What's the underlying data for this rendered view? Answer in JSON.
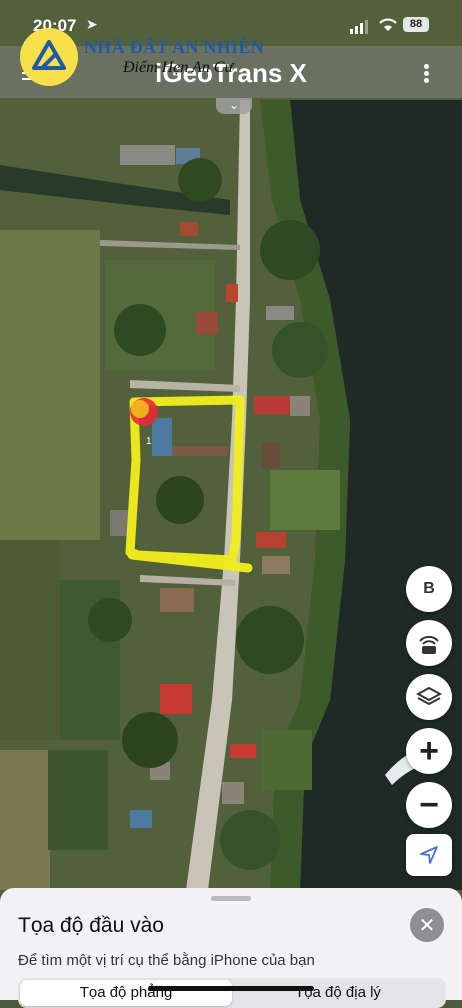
{
  "status": {
    "time": "20:07",
    "battery": "88"
  },
  "app": {
    "title": "iGeoTrans X"
  },
  "watermark": {
    "brand": "NHÀ ĐẤT AN NHIÊN",
    "slogan": "Điểm Hẹn An Cư"
  },
  "map": {
    "parcel_label": "1",
    "highlight_color": "#f2ee1a",
    "marker_color": "#e8283a"
  },
  "controls": {
    "compass_label": "B",
    "zoom_in": "+",
    "zoom_out": "−"
  },
  "sheet": {
    "title": "Tọa độ đầu vào",
    "description": "Để tìm một vị trí cụ thể bằng iPhone của bạn",
    "tabs": [
      "Tọa độ phẳng",
      "Tọa độ địa lý"
    ]
  }
}
